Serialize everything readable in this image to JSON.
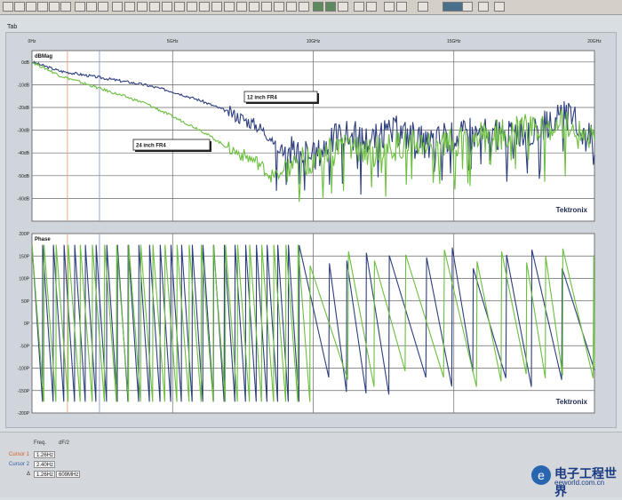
{
  "tab": {
    "label": "Tab"
  },
  "top_ticks": [
    "0Hz",
    "5GHz",
    "10GHz",
    "15GHz",
    "20GHz"
  ],
  "status": {
    "freq_label": "Freq.",
    "df_label": "dF/2",
    "cursor1_label": "Cursor 1",
    "cursor1_value": "1.26Hz",
    "cursor2_label": "Cursor 2",
    "cursor2_value": "2.40Hz",
    "delta_label": "Δ",
    "delta_value": "1.26Hz",
    "delta_extra": "609MHz"
  },
  "logo": {
    "chinese": "电子工程世界",
    "url": "eeworld.com.cn"
  },
  "chart_data": [
    {
      "type": "line",
      "title": "dBMag",
      "xlim": [
        0,
        20
      ],
      "ylim": [
        -70,
        5
      ],
      "x_ticks": [
        "0Hz",
        "5GHz",
        "10GHz",
        "15GHz",
        "20GHz"
      ],
      "y_ticks": [
        "0dB",
        "-10dB",
        "-20dB",
        "-30dB",
        "-40dB",
        "-50dB",
        "-60dB"
      ],
      "brand": "Tektronix",
      "x": [
        0,
        1,
        2,
        3,
        4,
        5,
        6,
        7,
        8,
        8.5,
        9,
        9.5,
        10,
        10.5,
        11,
        12,
        13,
        14,
        15,
        16,
        17,
        18,
        19,
        20
      ],
      "series": [
        {
          "name": "12 inch FR4",
          "color": "#2e3f7e",
          "values": [
            0,
            -4,
            -6,
            -8,
            -10,
            -13,
            -17,
            -22,
            -28,
            -33,
            -40,
            -38,
            -42,
            -36,
            -31,
            -34,
            -30,
            -35,
            -32,
            -31,
            -33,
            -30,
            -23,
            -35
          ]
        },
        {
          "name": "24 inch FR4",
          "color": "#6cbf3f",
          "values": [
            0,
            -6,
            -10,
            -14,
            -18,
            -24,
            -30,
            -38,
            -44,
            -50,
            -48,
            -45,
            -42,
            -40,
            -38,
            -40,
            -37,
            -36,
            -35,
            -33,
            -31,
            -29,
            -27,
            -32
          ]
        }
      ]
    },
    {
      "type": "line",
      "title": "Phase",
      "xlim": [
        0,
        20
      ],
      "ylim": [
        -200,
        200
      ],
      "y_ticks": [
        "200P",
        "150P",
        "100P",
        "50P",
        "0P",
        "-50P",
        "-100P",
        "-150P",
        "-200P"
      ],
      "brand": "Tektronix",
      "series": [
        {
          "name": "12 inch FR4",
          "color": "#2e3f7e",
          "period_ghz": 0.38
        },
        {
          "name": "24 inch FR4",
          "color": "#6cbf3f",
          "period_ghz": 0.43
        }
      ]
    }
  ],
  "plot_labels": {
    "series1_label": "12 inch FR4",
    "series2_label": "24 inch FR4"
  }
}
